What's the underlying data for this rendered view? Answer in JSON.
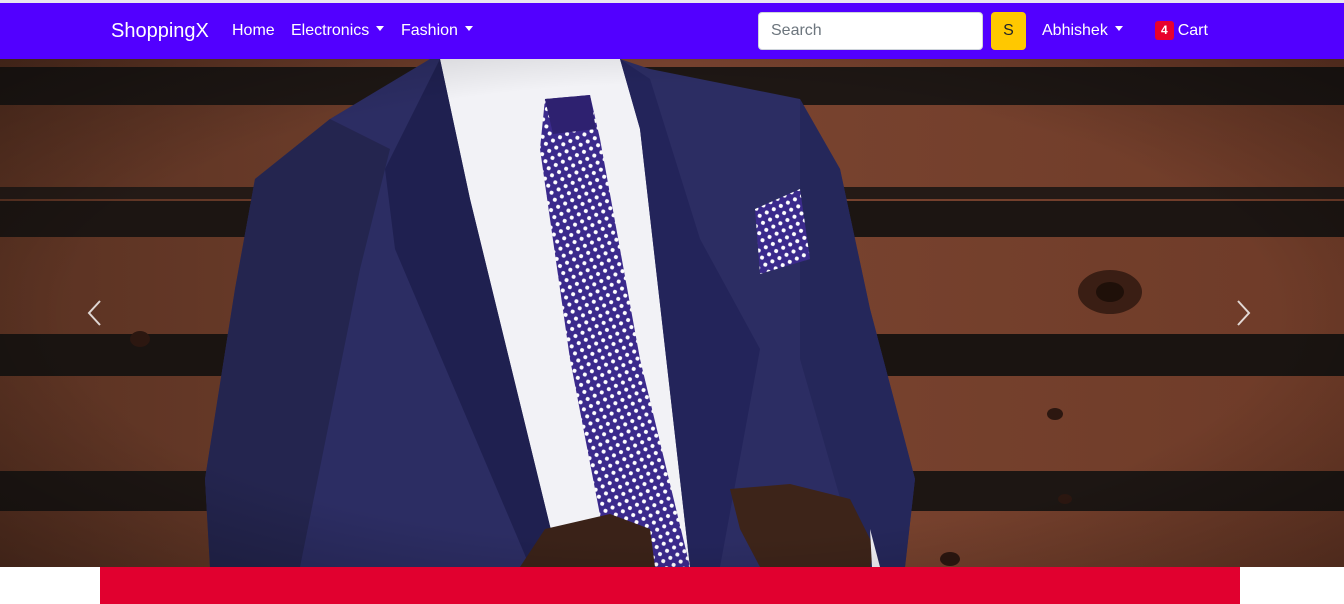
{
  "navbar": {
    "brand": "ShoppingX",
    "links": [
      {
        "label": "Home",
        "dropdown": false
      },
      {
        "label": "Electronics",
        "dropdown": true
      },
      {
        "label": "Fashion",
        "dropdown": true
      }
    ],
    "search": {
      "placeholder": "Search",
      "value": "",
      "button_label": "S"
    },
    "user": {
      "label": "Abhishek",
      "dropdown": true
    },
    "cart": {
      "count": "4",
      "label": "Cart"
    }
  },
  "carousel": {
    "image": "man in navy suit with polka-dot purple tie against wooden wall",
    "prev_icon": "chevron-left-icon",
    "next_icon": "chevron-right-icon"
  },
  "colors": {
    "navbar": "#5200ff",
    "search_button": "#ffc800",
    "cart_badge": "#e8002d",
    "banner": "#e1002f"
  }
}
